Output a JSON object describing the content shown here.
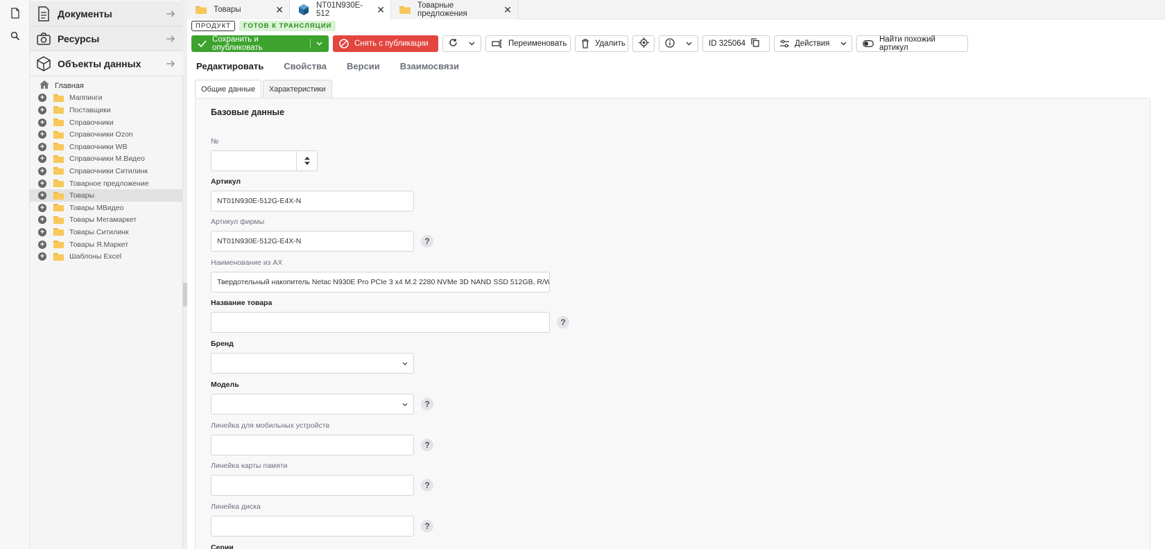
{
  "sidebar": {
    "sections": [
      {
        "label": "Документы"
      },
      {
        "label": "Ресурсы"
      },
      {
        "label": "Объекты данных"
      }
    ],
    "home_label": "Главная",
    "tree": [
      "Маппинги",
      "Поставщики",
      "Справочники",
      "Справочники Ozon",
      "Справочники WB",
      "Справочники М.Видео",
      "Справочники Ситилинк",
      "Товарное предложение",
      "Товары",
      "Товары МВидео",
      "Товары Мегамаркет",
      "Товары Ситилинк",
      "Товары Я.Маркет",
      "Шаблоны Excel"
    ],
    "selected_index": 8
  },
  "tabs": [
    {
      "label": "Товары",
      "icon": "folder-icon"
    },
    {
      "label": "NT01N930E-512",
      "icon": "cube-icon"
    },
    {
      "label": "Товарные предложения",
      "icon": "folder-icon"
    }
  ],
  "badges": {
    "type": "ПРОДУКТ",
    "status": "ГОТОВ К ТРАНСЛЯЦИИ"
  },
  "toolbar": {
    "save_publish": "Сохранить и опубликовать",
    "unpublish": "Снять с публикации",
    "rename": "Переименовать",
    "delete": "Удалить",
    "id_label": "ID 325064",
    "actions": "Действия",
    "find_similar": "Найти похожий артикул"
  },
  "nav": {
    "tabs": [
      "Редактировать",
      "Свойства",
      "Версии",
      "Взаимосвязи"
    ]
  },
  "subtabs": [
    "Общие данные",
    "Характеристики"
  ],
  "form": {
    "section_title": "Базовые данные",
    "number": {
      "label": "№",
      "value": ""
    },
    "article": {
      "label": "Артикул",
      "value": "NT01N930E-512G-E4X-N"
    },
    "firm_article": {
      "label": "Артикул фирмы",
      "value": "NT01N930E-512G-E4X-N"
    },
    "ax_name": {
      "label": "Наименование из AX",
      "value": "Твердотельный накопитель Netac N930E Pro PCIe 3 x4 M.2 2280 NVMe 3D NAND SSD 512GB, R/W"
    },
    "product_name": {
      "label": "Название товара",
      "value": ""
    },
    "brand": {
      "label": "Бренд",
      "value": ""
    },
    "model": {
      "label": "Модель",
      "value": ""
    },
    "mobile_line": {
      "label": "Линейка для мобильных устройств",
      "value": ""
    },
    "memcard_line": {
      "label": "Линейка карты памяти",
      "value": ""
    },
    "disk_line": {
      "label": "Линейка диска",
      "value": ""
    },
    "series": {
      "label": "Серии"
    }
  },
  "colors": {
    "accent_green": "#3ca32e",
    "accent_red": "#e3453f",
    "status_bg": "#d9f3d4"
  }
}
